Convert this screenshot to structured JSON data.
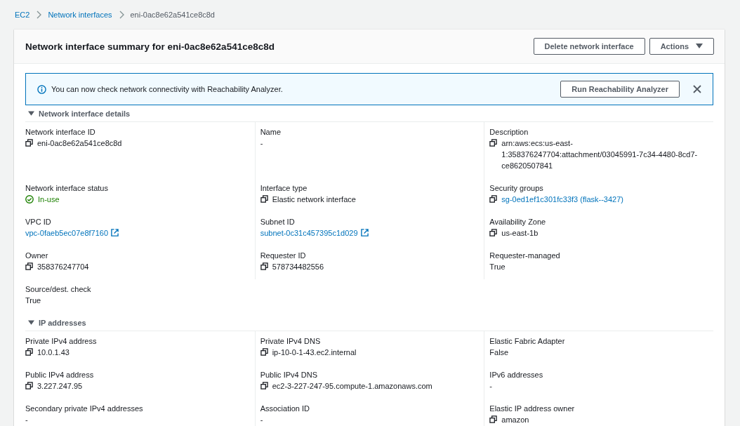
{
  "breadcrumbs": [
    {
      "label": "EC2",
      "kind": "link"
    },
    {
      "label": "Network interfaces",
      "kind": "link"
    },
    {
      "label": "eni-0ac8e62a541ce8c8d",
      "kind": "current"
    }
  ],
  "panel": {
    "title": "Network interface summary for eni-0ac8e62a541ce8c8d",
    "buttons": [
      {
        "label": "Delete network interface",
        "kind": "plain"
      },
      {
        "label": "Actions",
        "kind": "dropdown"
      }
    ]
  },
  "alert": {
    "message": "You can now check network connectivity with Reachability Analyzer.",
    "button": "Run Reachability Analyzer"
  },
  "sections": [
    {
      "title": "Network interface details",
      "expanded": true,
      "fields": [
        {
          "label": "Network interface ID",
          "value": "eni-0ac8e62a541ce8c8d",
          "kind": "copy"
        },
        {
          "label": "Name",
          "value": "-",
          "kind": "plain"
        },
        {
          "label": "Description",
          "value": "arn:aws:ecs:us-east-1:358376247704:attachment/03045991-7c34-4480-8cd7-ce8620507841",
          "kind": "copy"
        },
        {
          "label": "Network interface status",
          "value": "In-use",
          "kind": "status"
        },
        {
          "label": "Interface type",
          "value": "Elastic network interface",
          "kind": "copy"
        },
        {
          "label": "Security groups",
          "value": "sg-0ed1ef1c301fc33f3 (flask--3427)",
          "kind": "copy-link"
        },
        {
          "label": "VPC ID",
          "value": "vpc-0faeb5ec07e8f7160",
          "kind": "external-link"
        },
        {
          "label": "Subnet ID",
          "value": "subnet-0c31c457395c1d029",
          "kind": "external-link"
        },
        {
          "label": "Availability Zone",
          "value": "us-east-1b",
          "kind": "copy"
        },
        {
          "label": "Owner",
          "value": "358376247704",
          "kind": "copy"
        },
        {
          "label": "Requester ID",
          "value": "578734482556",
          "kind": "copy"
        },
        {
          "label": "Requester-managed",
          "value": "True",
          "kind": "plain"
        },
        {
          "label": "Source/dest. check",
          "value": "True",
          "kind": "plain"
        }
      ]
    },
    {
      "title": "IP addresses",
      "expanded": true,
      "fields": [
        {
          "label": "Private IPv4 address",
          "value": "10.0.1.43",
          "kind": "copy"
        },
        {
          "label": "Private IPv4 DNS",
          "value": "ip-10-0-1-43.ec2.internal",
          "kind": "copy"
        },
        {
          "label": "Elastic Fabric Adapter",
          "value": "False",
          "kind": "plain"
        },
        {
          "label": "Public IPv4 address",
          "value": "3.227.247.95",
          "kind": "copy"
        },
        {
          "label": "Public IPv4 DNS",
          "value": "ec2-3-227-247-95.compute-1.amazonaws.com",
          "kind": "copy"
        },
        {
          "label": "IPv6 addresses",
          "value": "-",
          "kind": "plain"
        },
        {
          "label": "Secondary private IPv4 addresses",
          "value": "-",
          "kind": "plain"
        },
        {
          "label": "Association ID",
          "value": "-",
          "kind": "plain"
        },
        {
          "label": "Elastic IP address owner",
          "value": "amazon",
          "kind": "copy"
        }
      ]
    }
  ]
}
